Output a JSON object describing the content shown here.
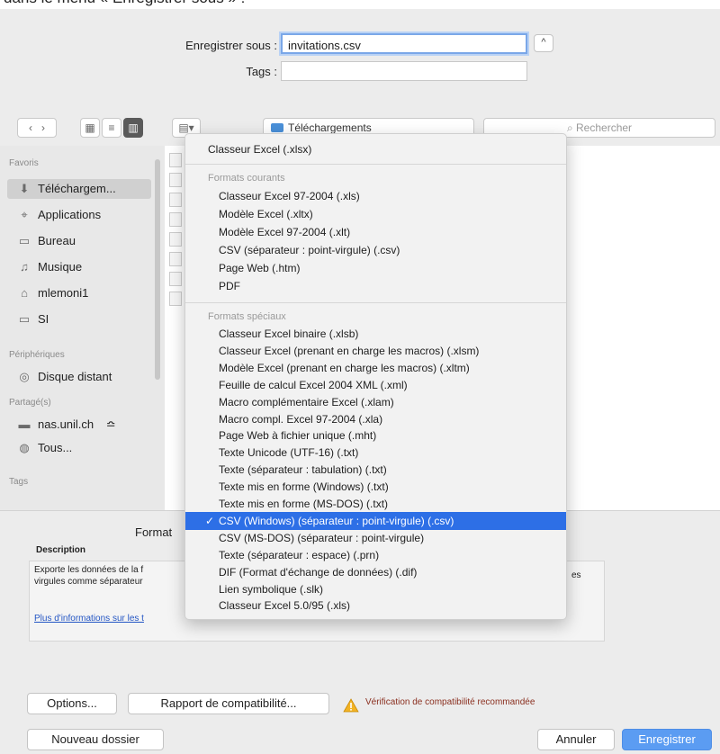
{
  "save_row": {
    "save_as_label": "Enregistrer sous :",
    "save_as_value": "invitations.csv",
    "tags_label": "Tags :",
    "tags_value": "",
    "collapse_glyph": "^"
  },
  "toolbar": {
    "location": "Téléchargements",
    "search_placeholder": "Rechercher"
  },
  "sidebar": {
    "favorites_header": "Favoris",
    "favorites": [
      {
        "label": "Téléchargem...",
        "icon": "downloads-icon"
      },
      {
        "label": "Applications",
        "icon": "applications-icon"
      },
      {
        "label": "Bureau",
        "icon": "desktop-icon"
      },
      {
        "label": "Musique",
        "icon": "music-icon"
      },
      {
        "label": "mlemoni1",
        "icon": "home-icon"
      },
      {
        "label": "SI",
        "icon": "folder-icon"
      }
    ],
    "devices_header": "Périphériques",
    "devices": [
      {
        "label": "Disque distant",
        "icon": "disk-icon"
      }
    ],
    "shared_header": "Partagé(s)",
    "shared": [
      {
        "label": "nas.unil.ch",
        "icon": "server-icon",
        "extra": "≏"
      },
      {
        "label": "Tous...",
        "icon": "network-icon"
      }
    ],
    "tags_header": "Tags"
  },
  "bottom": {
    "format_label": "Format",
    "description_header": "Description",
    "description_text_1": "Exporte les données de la f",
    "description_text_2": "virgules comme séparateur",
    "description_text_tail": "es",
    "more_info_link": "Plus d'informations sur les t",
    "options_button": "Options...",
    "compat_button": "Rapport de compatibilité...",
    "warning_text": "Vérification de compatibilité recommandée",
    "new_folder_button": "Nouveau dossier",
    "cancel_button": "Annuler",
    "save_button": "Enregistrer"
  },
  "menu": {
    "top_item": "Classeur Excel (.xlsx)",
    "common_header": "Formats courants",
    "common": [
      "Classeur Excel 97-2004 (.xls)",
      "Modèle Excel (.xltx)",
      "Modèle Excel 97-2004 (.xlt)",
      "CSV (séparateur : point-virgule) (.csv)",
      "Page Web (.htm)",
      "PDF"
    ],
    "special_header": "Formats spéciaux",
    "special": [
      "Classeur Excel binaire (.xlsb)",
      "Classeur Excel (prenant en charge les macros) (.xlsm)",
      "Modèle Excel (prenant en charge les macros) (.xltm)",
      "Feuille de calcul Excel 2004 XML (.xml)",
      "Macro complémentaire Excel (.xlam)",
      "Macro compl. Excel 97-2004 (.xla)",
      "Page Web à fichier unique (.mht)",
      "Texte Unicode (UTF-16) (.txt)",
      "Texte (séparateur : tabulation) (.txt)",
      "Texte mis en forme (Windows) (.txt)",
      "Texte mis en forme (MS-DOS) (.txt)",
      "CSV (Windows) (séparateur : point-virgule) (.csv)",
      "CSV (MS-DOS) (séparateur : point-virgule)",
      "Texte (séparateur : espace) (.prn)",
      "DIF (Format d'échange de données) (.dif)",
      "Lien symbolique (.slk)",
      "Classeur Excel 5.0/95 (.xls)"
    ],
    "selected_index": 11,
    "checkmark": "✓"
  },
  "colors": {
    "accent": "#2d6fe6",
    "primary_button": "#5b9cf2",
    "warning": "#8a2f1f"
  }
}
